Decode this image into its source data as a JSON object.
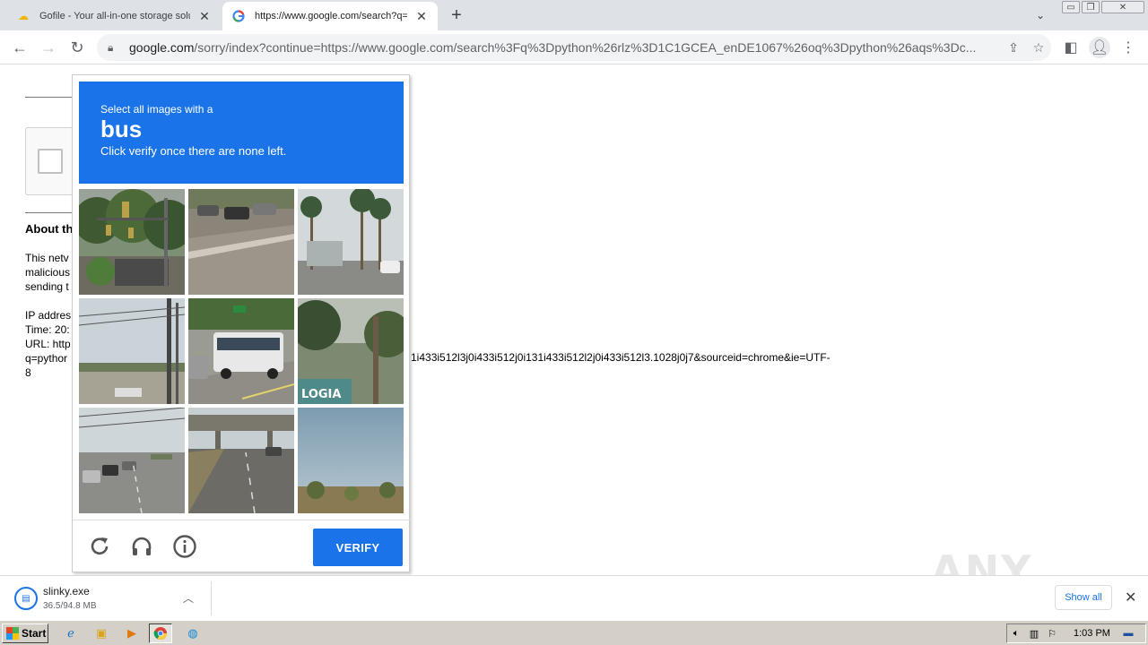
{
  "browser": {
    "tabs": [
      {
        "title": "Gofile - Your all-in-one storage soluti",
        "favicon": "gofile-icon",
        "active": false
      },
      {
        "title": "https://www.google.com/search?q=",
        "favicon": "google-g-icon",
        "active": true
      }
    ],
    "new_tab": "+",
    "omnibox": {
      "host": "google.com",
      "rest": "/sorry/index?continue=https://www.google.com/search%3Fq%3Dpython%26rlz%3D1C1GCEA_enDE1067%26oq%3Dpython%26aqs%3Dc..."
    }
  },
  "page": {
    "about_title": "About th",
    "para1": [
      "This netv",
      "malicious",
      "sending t"
    ],
    "para2": [
      "IP addres",
      "Time: 20:",
      "URL: http",
      "q=pythor",
      "8"
    ],
    "url_tail": "1i433i512l3j0i433i512j0i131i433i512l2j0i433i512l3.1028j0j7&sourceid=chrome&ie=UTF-"
  },
  "captcha": {
    "instruction_line1": "Select all images with a",
    "target": "bus",
    "instruction_line3": "Click verify once there are none left.",
    "tiles": [
      {
        "desc": "trees-traffic-light"
      },
      {
        "desc": "parking-lot"
      },
      {
        "desc": "palm-street"
      },
      {
        "desc": "power-poles-road"
      },
      {
        "desc": "bus-intersection"
      },
      {
        "desc": "palm-sign"
      },
      {
        "desc": "highway-cars"
      },
      {
        "desc": "overpass-road"
      },
      {
        "desc": "sky-field"
      }
    ],
    "verify_label": "VERIFY",
    "sign_text": "LOGIA"
  },
  "download": {
    "filename": "slinky.exe",
    "progress": "36.5/94.8 MB",
    "show_all": "Show all"
  },
  "watermark": "ANY RUN",
  "taskbar": {
    "start_label": "Start",
    "clock": "1:03 PM"
  },
  "colors": {
    "accent": "#1a73e8",
    "tabstrip": "#dee1e6",
    "taskbar": "#d4d0c8"
  }
}
